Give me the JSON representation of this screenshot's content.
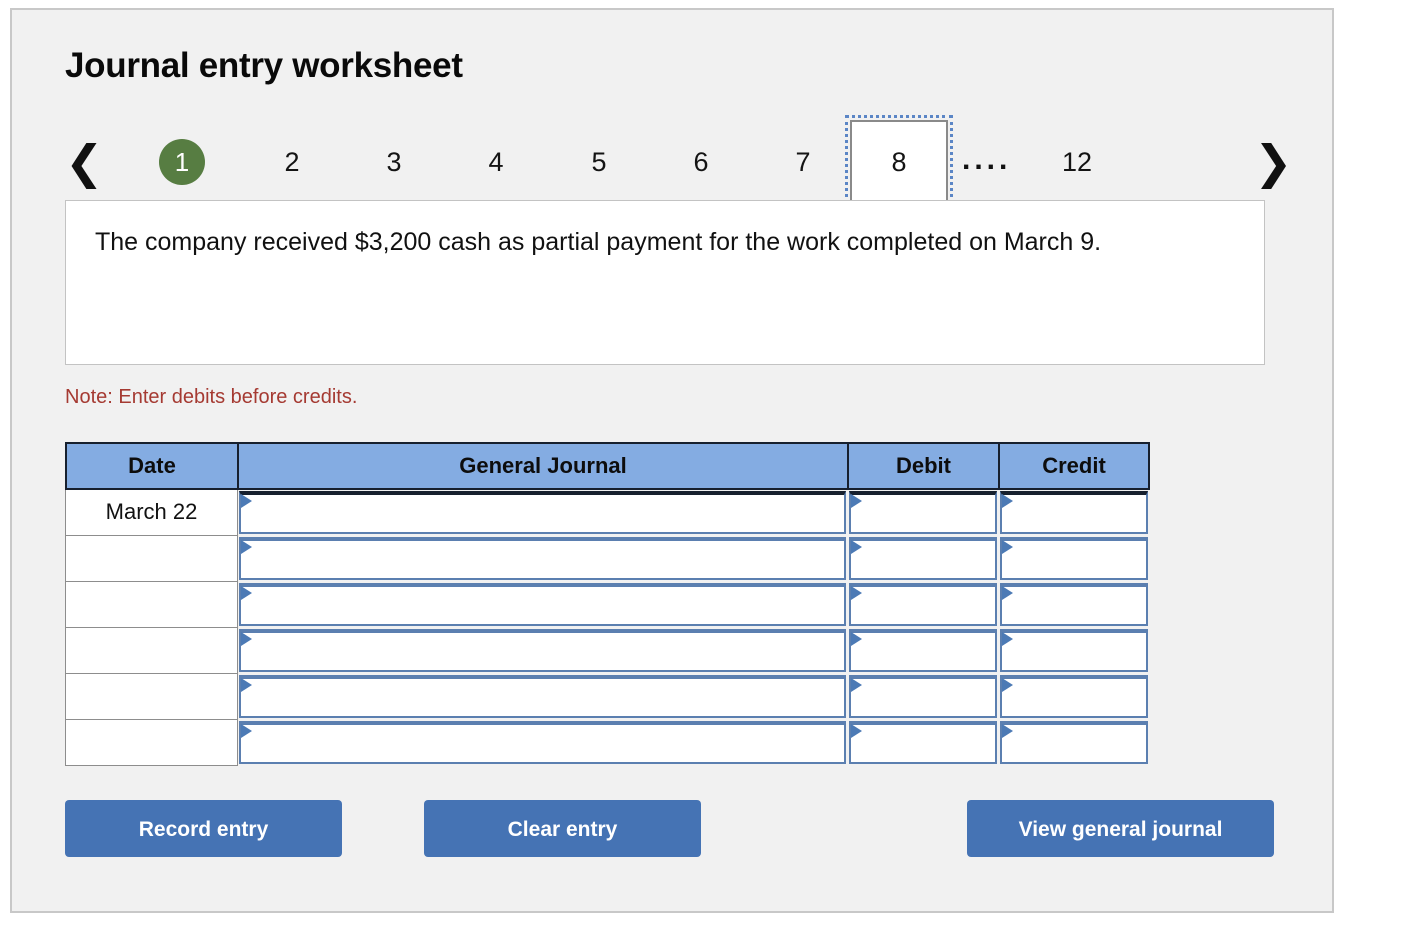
{
  "header": {
    "title": "Journal entry worksheet"
  },
  "pager": {
    "prev_icon": "chevron-left-icon",
    "next_icon": "chevron-right-icon",
    "ellipsis": "....",
    "items": [
      {
        "label": "1",
        "state": "current"
      },
      {
        "label": "2",
        "state": "normal"
      },
      {
        "label": "3",
        "state": "normal"
      },
      {
        "label": "4",
        "state": "normal"
      },
      {
        "label": "5",
        "state": "normal"
      },
      {
        "label": "6",
        "state": "normal"
      },
      {
        "label": "7",
        "state": "normal"
      },
      {
        "label": "8",
        "state": "boxed"
      },
      {
        "label": "12",
        "state": "normal"
      }
    ]
  },
  "description": {
    "text": "The company received $3,200 cash as partial payment for the work completed on March 9."
  },
  "note": {
    "text": "Note: Enter debits before credits."
  },
  "journal": {
    "columns": [
      {
        "key": "date",
        "label": "Date"
      },
      {
        "key": "gj",
        "label": "General Journal"
      },
      {
        "key": "debit",
        "label": "Debit"
      },
      {
        "key": "credit",
        "label": "Credit"
      }
    ],
    "rows": [
      {
        "date": "March 22",
        "gj": "",
        "debit": "",
        "credit": ""
      },
      {
        "date": "",
        "gj": "",
        "debit": "",
        "credit": ""
      },
      {
        "date": "",
        "gj": "",
        "debit": "",
        "credit": ""
      },
      {
        "date": "",
        "gj": "",
        "debit": "",
        "credit": ""
      },
      {
        "date": "",
        "gj": "",
        "debit": "",
        "credit": ""
      },
      {
        "date": "",
        "gj": "",
        "debit": "",
        "credit": ""
      }
    ]
  },
  "actions": {
    "record_label": "Record entry",
    "clear_label": "Clear entry",
    "view_label": "View general journal"
  },
  "colors": {
    "panel_bg": "#f1f1f1",
    "table_header_blue": "#84ace2",
    "button_blue": "#4573b4",
    "current_page_green": "#577d42",
    "note_red": "#a53a32",
    "input_border_blue": "#5b7fb0"
  }
}
